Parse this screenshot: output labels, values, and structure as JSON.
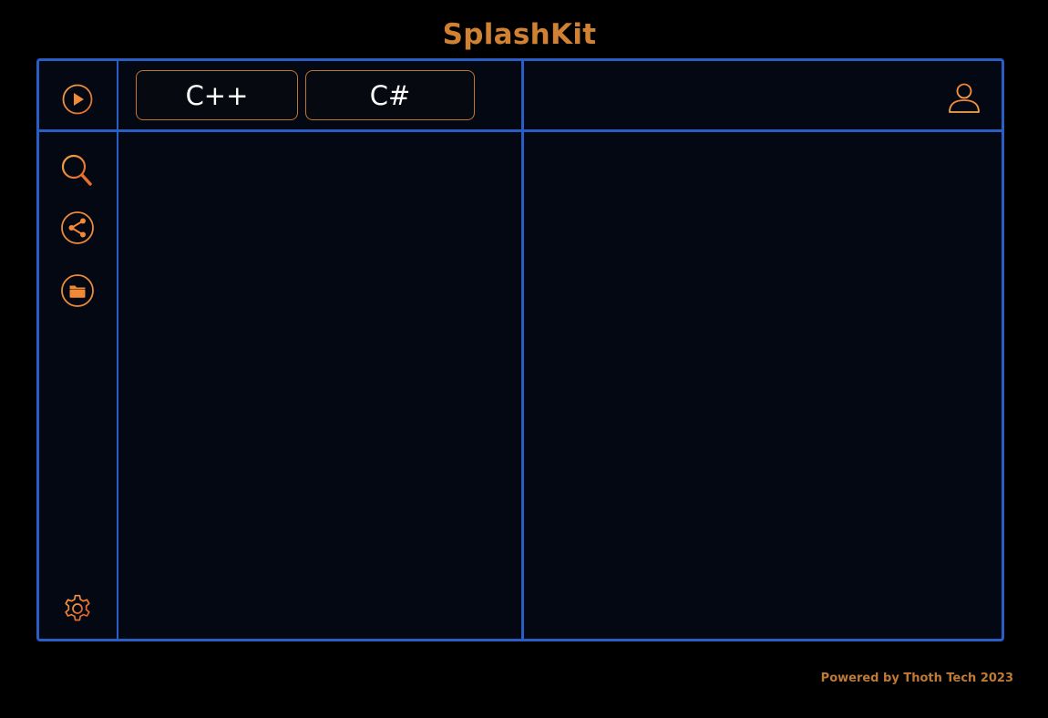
{
  "app": {
    "title": "SplashKit"
  },
  "toolbar": {
    "run_icon": "play-circle-icon",
    "profile_icon": "user-icon"
  },
  "tabs": [
    {
      "label": "C++"
    },
    {
      "label": "C#"
    }
  ],
  "sidebar": {
    "items": [
      {
        "icon": "search-icon"
      },
      {
        "icon": "share-icon"
      },
      {
        "icon": "folder-icon"
      }
    ],
    "settings_icon": "gear-icon"
  },
  "footer": {
    "text": "Powered by Thoth Tech 2023"
  },
  "colors": {
    "background": "#000000",
    "panel": "#040812",
    "border": "#2A5EC4",
    "accent": "#D08232",
    "text": "#FFFFFF"
  }
}
